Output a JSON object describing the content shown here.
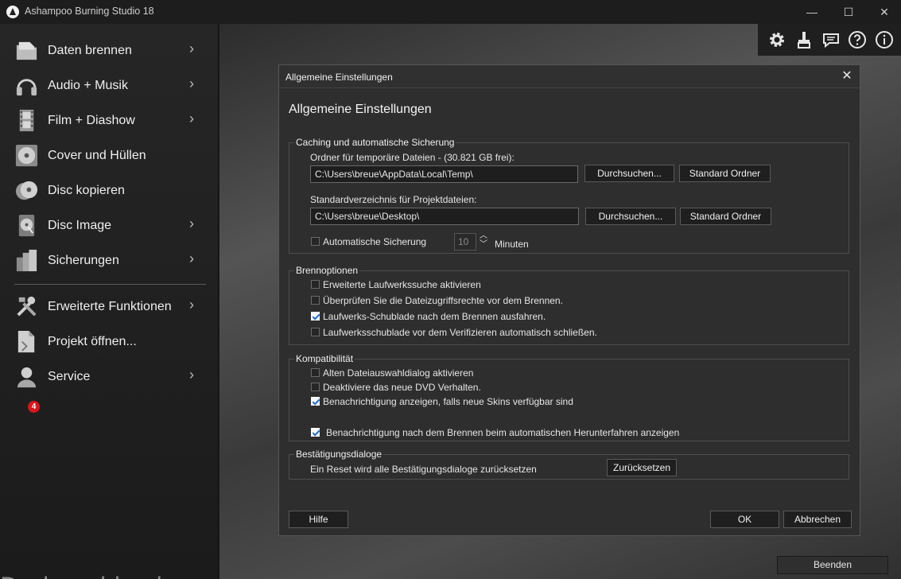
{
  "app": {
    "title": "Ashampoo Burning Studio 18"
  },
  "window_controls": {
    "minimize": "—",
    "maximize": "☐",
    "close": "✕"
  },
  "sidebar": {
    "items": [
      {
        "label": "Daten brennen",
        "icon": "data-folder-icon",
        "chevron": true
      },
      {
        "label": "Audio + Musik",
        "icon": "headphones-icon",
        "chevron": true
      },
      {
        "label": "Film + Diashow",
        "icon": "film-strip-icon",
        "chevron": true
      },
      {
        "label": "Cover und Hüllen",
        "icon": "disc-cover-icon",
        "chevron": false
      },
      {
        "label": "Disc kopieren",
        "icon": "disc-copy-icon",
        "chevron": false
      },
      {
        "label": "Disc Image",
        "icon": "disc-image-icon",
        "chevron": true
      },
      {
        "label": "Sicherungen",
        "icon": "backup-icon",
        "chevron": true
      },
      {
        "label": "Erweiterte Funktionen",
        "icon": "tools-icon",
        "chevron": true
      },
      {
        "label": "Projekt öffnen...",
        "icon": "open-project-icon",
        "chevron": false
      },
      {
        "label": "Service",
        "icon": "service-user-icon",
        "chevron": true
      }
    ],
    "chevron_glyph": "›",
    "service_badge": "4"
  },
  "watermark": "Deskmodder.de",
  "toolbar": {
    "icons": [
      "gear-icon",
      "brush-icon",
      "feedback-icon",
      "help-icon",
      "info-icon"
    ]
  },
  "quit_label": "Beenden",
  "dialog": {
    "window_title": "Allgemeine Einstellungen",
    "heading": "Allgemeine Einstellungen",
    "close_glyph": "✕",
    "caching": {
      "title": "Caching und automatische Sicherung",
      "temp_label": "Ordner für temporäre Dateien - (30.821  GB frei):",
      "temp_value": "C:\\Users\\breue\\AppData\\Local\\Temp\\",
      "project_label": "Standardverzeichnis für Projektdateien:",
      "project_value": "C:\\Users\\breue\\Desktop\\",
      "browse_label": "Durchsuchen...",
      "default_folder_label": "Standard Ordner",
      "autosave_label": "Automatische Sicherung",
      "autosave_checked": false,
      "autosave_minutes": "10",
      "minutes_label": "Minuten"
    },
    "burn_options": {
      "title": "Brennoptionen",
      "options": [
        {
          "label": "Erweiterte Laufwerkssuche aktivieren",
          "checked": false
        },
        {
          "label": "Überprüfen Sie die Dateizugriffsrechte vor dem Brennen.",
          "checked": false
        },
        {
          "label": "Laufwerks-Schublade nach dem Brennen ausfahren.",
          "checked": true
        },
        {
          "label": "Laufwerksschublade vor dem Verifizieren automatisch schließen.",
          "checked": false
        }
      ]
    },
    "compatibility": {
      "title": "Kompatibilität",
      "options": [
        {
          "label": "Alten Dateiauswahldialog aktivieren",
          "checked": false
        },
        {
          "label": "Deaktiviere das neue DVD Verhalten.",
          "checked": false
        },
        {
          "label": "Benachrichtigung anzeigen, falls neue Skins verfügbar sind",
          "checked": true
        },
        {
          "label": "Benachrichtigung nach dem Brennen beim automatischen Herunterfahren anzeigen",
          "checked": true
        }
      ]
    },
    "confirm_dialogs": {
      "title": "Bestätigungsdialoge",
      "reset_text": "Ein Reset wird alle Bestätigungsdialoge zurücksetzen",
      "reset_button": "Zurücksetzen"
    },
    "help_button": "Hilfe",
    "ok_button": "OK",
    "cancel_button": "Abbrechen"
  }
}
